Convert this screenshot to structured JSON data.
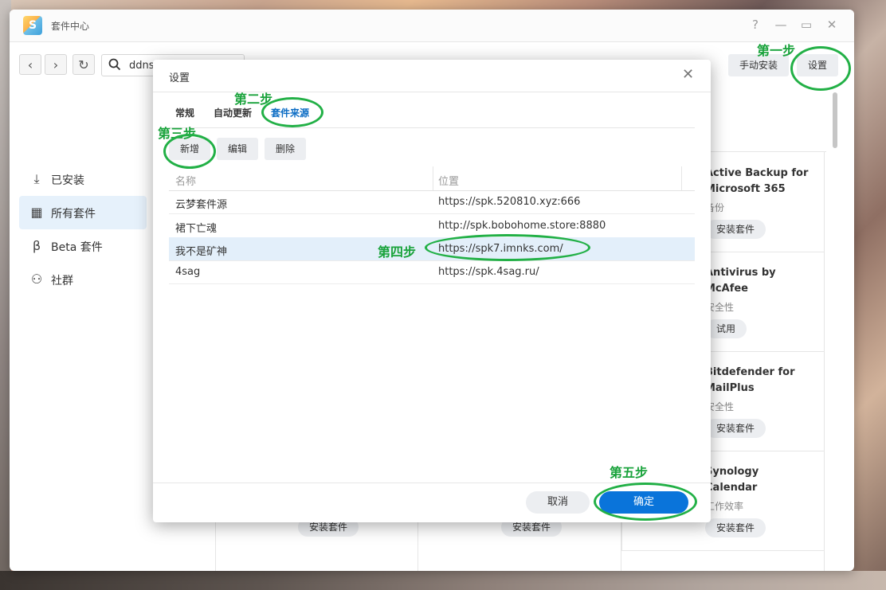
{
  "app": {
    "title": "套件中心",
    "window_controls": [
      "?",
      "—",
      "▭",
      "✕"
    ]
  },
  "toolbar": {
    "back_icon": "chevron-left-icon",
    "forward_icon": "chevron-right-icon",
    "refresh_icon": "refresh-icon",
    "search_value": "ddns",
    "manual_install_label": "手动安装",
    "settings_label": "设置"
  },
  "sidebar": {
    "items": [
      {
        "label": "已安装",
        "icon": "download-icon"
      },
      {
        "label": "所有套件",
        "icon": "grid-icon",
        "active": true
      },
      {
        "label": "Beta 套件",
        "icon": "beta-icon"
      },
      {
        "label": "社群",
        "icon": "community-icon"
      }
    ]
  },
  "packages": [
    {
      "name_lines": [
        "Active Backup for",
        "Microsoft 365"
      ],
      "category": "备份",
      "button": "安装套件"
    },
    {
      "name_lines": [
        "Antivirus by",
        "McAfee"
      ],
      "category": "安全性",
      "button": "试用"
    },
    {
      "name_lines": [
        "Bitdefender for",
        "MailPlus"
      ],
      "category": "安全性",
      "button": "安装套件"
    },
    {
      "name_lines": [
        "Synology",
        "Calendar"
      ],
      "category": "工作效率",
      "button": "安装套件"
    }
  ],
  "bottom_row_buttons": [
    "安装套件",
    "安装套件"
  ],
  "dialog": {
    "title": "设置",
    "tabs": [
      {
        "label": "常规"
      },
      {
        "label": "自动更新"
      },
      {
        "label": "套件来源",
        "active": true
      }
    ],
    "actions": {
      "add": "新增",
      "edit": "编辑",
      "delete": "删除"
    },
    "table": {
      "columns": [
        "名称",
        "位置"
      ],
      "rows": [
        {
          "name": "云梦套件源",
          "location": "https://spk.520810.xyz:666"
        },
        {
          "name": "裙下亡魂",
          "location": "http://spk.bobohome.store:8880"
        },
        {
          "name": "我不是矿神",
          "location": "https://spk7.imnks.com/",
          "selected": true
        },
        {
          "name": "4sag",
          "location": "https://spk.4sag.ru/"
        }
      ]
    },
    "cancel_label": "取消",
    "ok_label": "确定"
  },
  "annotations": {
    "step1": "第一步",
    "step2": "第二步",
    "step3": "第三步",
    "step4": "第四步",
    "step5": "第五步",
    "color": "#22b046"
  }
}
